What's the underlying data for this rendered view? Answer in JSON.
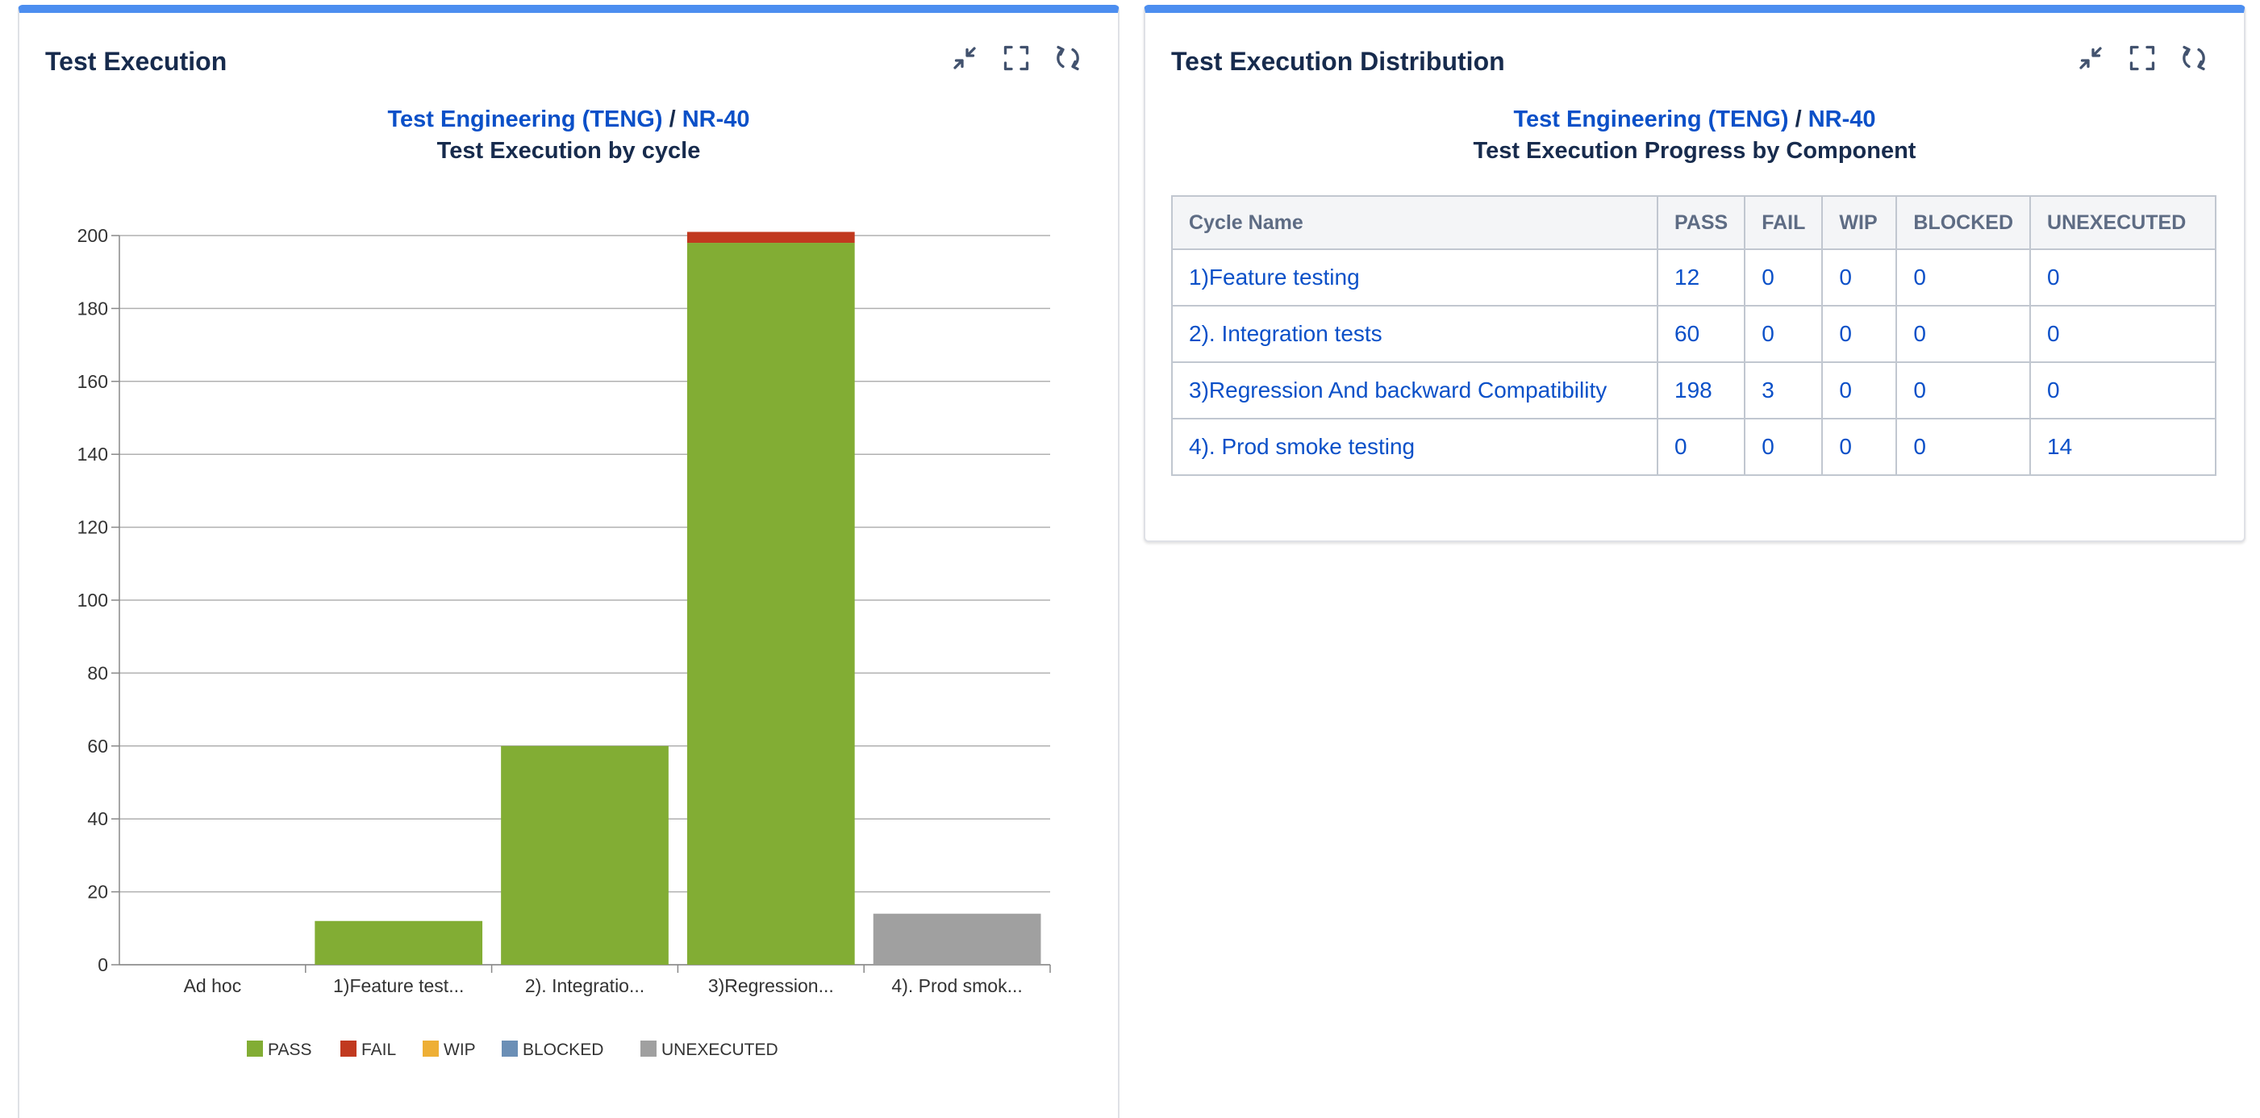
{
  "project_link": "Test Engineering (TENG)",
  "separator": "/",
  "version_link": "NR-40",
  "colors": {
    "PASS": "#82ad34",
    "FAIL": "#c1391f",
    "WIP": "#eeaf35",
    "BLOCKED": "#6b8fb6",
    "UNEXECUTED": "#a0a0a0",
    "link": "#0b50c8",
    "header_bar": "#4c8ef0"
  },
  "left_gadget": {
    "title": "Test Execution",
    "actions": [
      {
        "name": "minimize-icon"
      },
      {
        "name": "maximize-icon"
      },
      {
        "name": "refresh-icon"
      }
    ],
    "chart_title": "Test Execution by cycle"
  },
  "chart_data": {
    "type": "bar",
    "stacked": true,
    "categories": [
      "Ad hoc",
      "1)Feature test...",
      "2). Integratio...",
      "3)Regression...",
      "4). Prod smok..."
    ],
    "series": [
      {
        "name": "PASS",
        "values": [
          0,
          12,
          60,
          198,
          0
        ]
      },
      {
        "name": "FAIL",
        "values": [
          0,
          0,
          0,
          3,
          0
        ]
      },
      {
        "name": "WIP",
        "values": [
          0,
          0,
          0,
          0,
          0
        ]
      },
      {
        "name": "BLOCKED",
        "values": [
          0,
          0,
          0,
          0,
          0
        ]
      },
      {
        "name": "UNEXECUTED",
        "values": [
          0,
          0,
          0,
          0,
          14
        ]
      }
    ],
    "ylim": [
      0,
      200
    ],
    "yticks": [
      0,
      20,
      40,
      60,
      80,
      100,
      120,
      140,
      160,
      180,
      200
    ],
    "grid": true,
    "legend": "bottom"
  },
  "right_gadget": {
    "title": "Test Execution Distribution",
    "chart_title": "Test Execution Progress by Component",
    "table": {
      "headers": [
        "Cycle Name",
        "PASS",
        "FAIL",
        "WIP",
        "BLOCKED",
        "UNEXECUTED"
      ],
      "rows": [
        [
          "1)Feature testing",
          "12",
          "0",
          "0",
          "0",
          "0"
        ],
        [
          "2). Integration tests",
          "60",
          "0",
          "0",
          "0",
          "0"
        ],
        [
          "3)Regression And backward Compatibility",
          "198",
          "3",
          "0",
          "0",
          "0"
        ],
        [
          "4). Prod smoke testing",
          "0",
          "0",
          "0",
          "0",
          "14"
        ]
      ]
    }
  }
}
